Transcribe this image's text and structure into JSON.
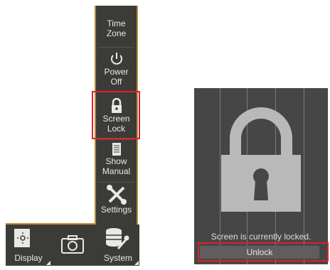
{
  "menu": {
    "time_zone": "Time\nZone",
    "power_off": "Power\nOff",
    "screen_lock": "Screen\nLock",
    "show_manual": "Show\nManual",
    "settings": "Settings"
  },
  "bottom_bar": {
    "display": "Display",
    "system": "System"
  },
  "lock_screen": {
    "message": "Screen is currently locked.",
    "unlock_label": "Unlock"
  },
  "colors": {
    "panel": "#3b3b37",
    "accent": "#c88d33",
    "highlight": "#e0202a",
    "screen_bg": "#464646"
  }
}
